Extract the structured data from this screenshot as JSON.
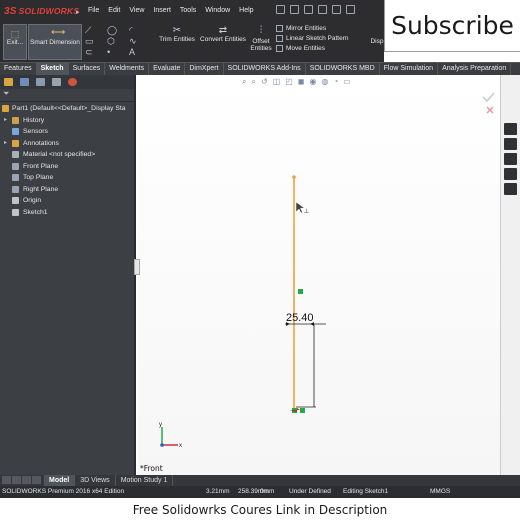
{
  "app": {
    "logo_text": "SOLIDWORKS",
    "logo_prefix": "3S"
  },
  "menu": [
    "File",
    "Edit",
    "View",
    "Insert",
    "Tools",
    "Window",
    "Help"
  ],
  "overlay": {
    "subscribe_text": "Subscribe",
    "caption": "Free Solidowrks Coures Link in Description"
  },
  "commands": {
    "exit_sketch": "Exit...",
    "smart_dimension": "Smart Dimension",
    "trim_entities": "Trim Entities",
    "convert_entities": "Convert Entities",
    "offset_entities": "Offset Entities",
    "mirror_entities": "Mirror Entities",
    "linear_sketch_pattern": "Linear Sketch Pattern",
    "move_entities": "Move Entities",
    "display": "Disp"
  },
  "tabs": [
    {
      "label": "Features",
      "active": false
    },
    {
      "label": "Sketch",
      "active": true
    },
    {
      "label": "Surfaces",
      "active": false
    },
    {
      "label": "Weldments",
      "active": false
    },
    {
      "label": "Evaluate",
      "active": false
    },
    {
      "label": "DimXpert",
      "active": false
    },
    {
      "label": "SOLIDWORKS Add-Ins",
      "active": false
    },
    {
      "label": "SOLIDWORKS MBD",
      "active": false
    },
    {
      "label": "Flow Simulation",
      "active": false
    },
    {
      "label": "Analysis Preparation",
      "active": false
    }
  ],
  "tree": {
    "root": "Part1  (Default<<Default>_Display Sta",
    "items": [
      {
        "label": "History",
        "expandable": true,
        "icon_color": "#c9a24a"
      },
      {
        "label": "Sensors",
        "expandable": false,
        "icon_color": "#7aa7d8"
      },
      {
        "label": "Annotations",
        "expandable": true,
        "icon_color": "#d9a441"
      },
      {
        "label": "Material <not specified>",
        "expandable": false,
        "icon_color": "#aab0b8"
      },
      {
        "label": "Front Plane",
        "expandable": false,
        "icon_color": "#9aa4b0"
      },
      {
        "label": "Top Plane",
        "expandable": false,
        "icon_color": "#9aa4b0"
      },
      {
        "label": "Right Plane",
        "expandable": false,
        "icon_color": "#9aa4b0"
      },
      {
        "label": "Origin",
        "expandable": false,
        "icon_color": "#c0c4ca"
      },
      {
        "label": "Sketch1",
        "expandable": false,
        "icon_color": "#c0c4ca"
      }
    ]
  },
  "sketch": {
    "dimension_value": "25.40",
    "view_label": "*Front",
    "line_color": "#f2a13a",
    "relation_color": "#22aa44"
  },
  "model_tabs": [
    {
      "label": "Model",
      "active": true
    },
    {
      "label": "3D Views",
      "active": false
    },
    {
      "label": "Motion Study 1",
      "active": false
    }
  ],
  "status": {
    "edition": "SOLIDWORKS Premium 2016 x64 Edition",
    "x": "3.21mm",
    "y": "258.39mm",
    "z": "0mm",
    "state": "Under Defined",
    "editing": "Editing Sketch1",
    "units": "MMGS"
  }
}
